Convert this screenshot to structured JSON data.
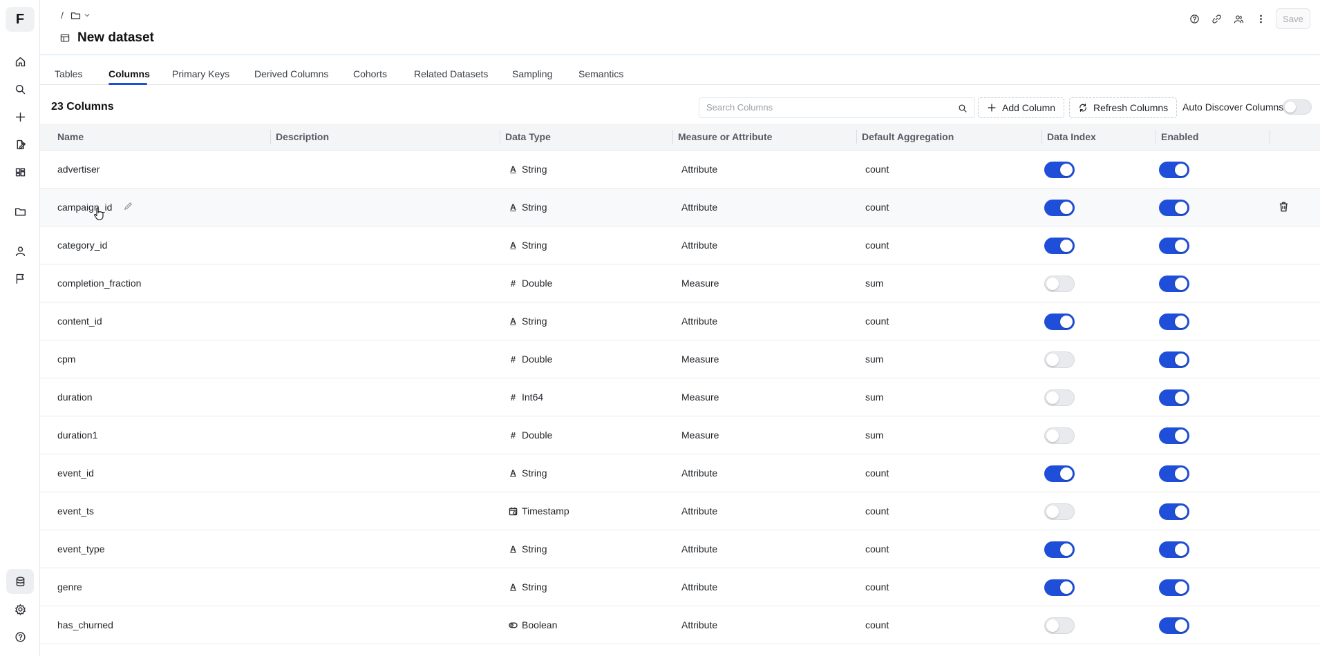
{
  "app": {
    "logo": "F",
    "title": "New dataset",
    "breadcrumb_sep": "/"
  },
  "header": {
    "save_label": "Save"
  },
  "tabs": [
    {
      "label": "Tables",
      "active": false
    },
    {
      "label": "Columns",
      "active": true
    },
    {
      "label": "Primary Keys",
      "active": false
    },
    {
      "label": "Derived Columns",
      "active": false
    },
    {
      "label": "Cohorts",
      "active": false
    },
    {
      "label": "Related Datasets",
      "active": false
    },
    {
      "label": "Sampling",
      "active": false
    },
    {
      "label": "Semantics",
      "active": false
    }
  ],
  "toolbar": {
    "count_label": "23 Columns",
    "search_placeholder": "Search Columns",
    "search_value": "",
    "add_label": "Add Column",
    "refresh_label": "Refresh Columns",
    "auto_discover_label": "Auto Discover Columns",
    "auto_discover_on": false
  },
  "columns": {
    "name": "Name",
    "description": "Description",
    "data_type": "Data Type",
    "measure": "Measure or Attribute",
    "aggregation": "Default Aggregation",
    "data_index": "Data Index",
    "enabled": "Enabled"
  },
  "rows": [
    {
      "name": "advertiser",
      "description": "",
      "type": "String",
      "type_icon": "string-icon",
      "kind": "Attribute",
      "agg": "count",
      "index": true,
      "enabled": true
    },
    {
      "name": "campaign_id",
      "description": "",
      "type": "String",
      "type_icon": "string-icon",
      "kind": "Attribute",
      "agg": "count",
      "index": true,
      "enabled": true
    },
    {
      "name": "category_id",
      "description": "",
      "type": "String",
      "type_icon": "string-icon",
      "kind": "Attribute",
      "agg": "count",
      "index": true,
      "enabled": true
    },
    {
      "name": "completion_fraction",
      "description": "",
      "type": "Double",
      "type_icon": "number-icon",
      "kind": "Measure",
      "agg": "sum",
      "index": false,
      "enabled": true
    },
    {
      "name": "content_id",
      "description": "",
      "type": "String",
      "type_icon": "string-icon",
      "kind": "Attribute",
      "agg": "count",
      "index": true,
      "enabled": true
    },
    {
      "name": "cpm",
      "description": "",
      "type": "Double",
      "type_icon": "number-icon",
      "kind": "Measure",
      "agg": "sum",
      "index": false,
      "enabled": true
    },
    {
      "name": "duration",
      "description": "",
      "type": "Int64",
      "type_icon": "number-icon",
      "kind": "Measure",
      "agg": "sum",
      "index": false,
      "enabled": true
    },
    {
      "name": "duration1",
      "description": "",
      "type": "Double",
      "type_icon": "number-icon",
      "kind": "Measure",
      "agg": "sum",
      "index": false,
      "enabled": true
    },
    {
      "name": "event_id",
      "description": "",
      "type": "String",
      "type_icon": "string-icon",
      "kind": "Attribute",
      "agg": "count",
      "index": true,
      "enabled": true
    },
    {
      "name": "event_ts",
      "description": "",
      "type": "Timestamp",
      "type_icon": "timestamp-icon",
      "kind": "Attribute",
      "agg": "count",
      "index": false,
      "enabled": true
    },
    {
      "name": "event_type",
      "description": "",
      "type": "String",
      "type_icon": "string-icon",
      "kind": "Attribute",
      "agg": "count",
      "index": true,
      "enabled": true
    },
    {
      "name": "genre",
      "description": "",
      "type": "String",
      "type_icon": "string-icon",
      "kind": "Attribute",
      "agg": "count",
      "index": true,
      "enabled": true
    },
    {
      "name": "has_churned",
      "description": "",
      "type": "Boolean",
      "type_icon": "boolean-icon",
      "kind": "Attribute",
      "agg": "count",
      "index": false,
      "enabled": true
    }
  ],
  "colors": {
    "accent": "#1f4fd8",
    "toggle_off": "#e8eaed",
    "header_bg": "#f4f5f7"
  }
}
